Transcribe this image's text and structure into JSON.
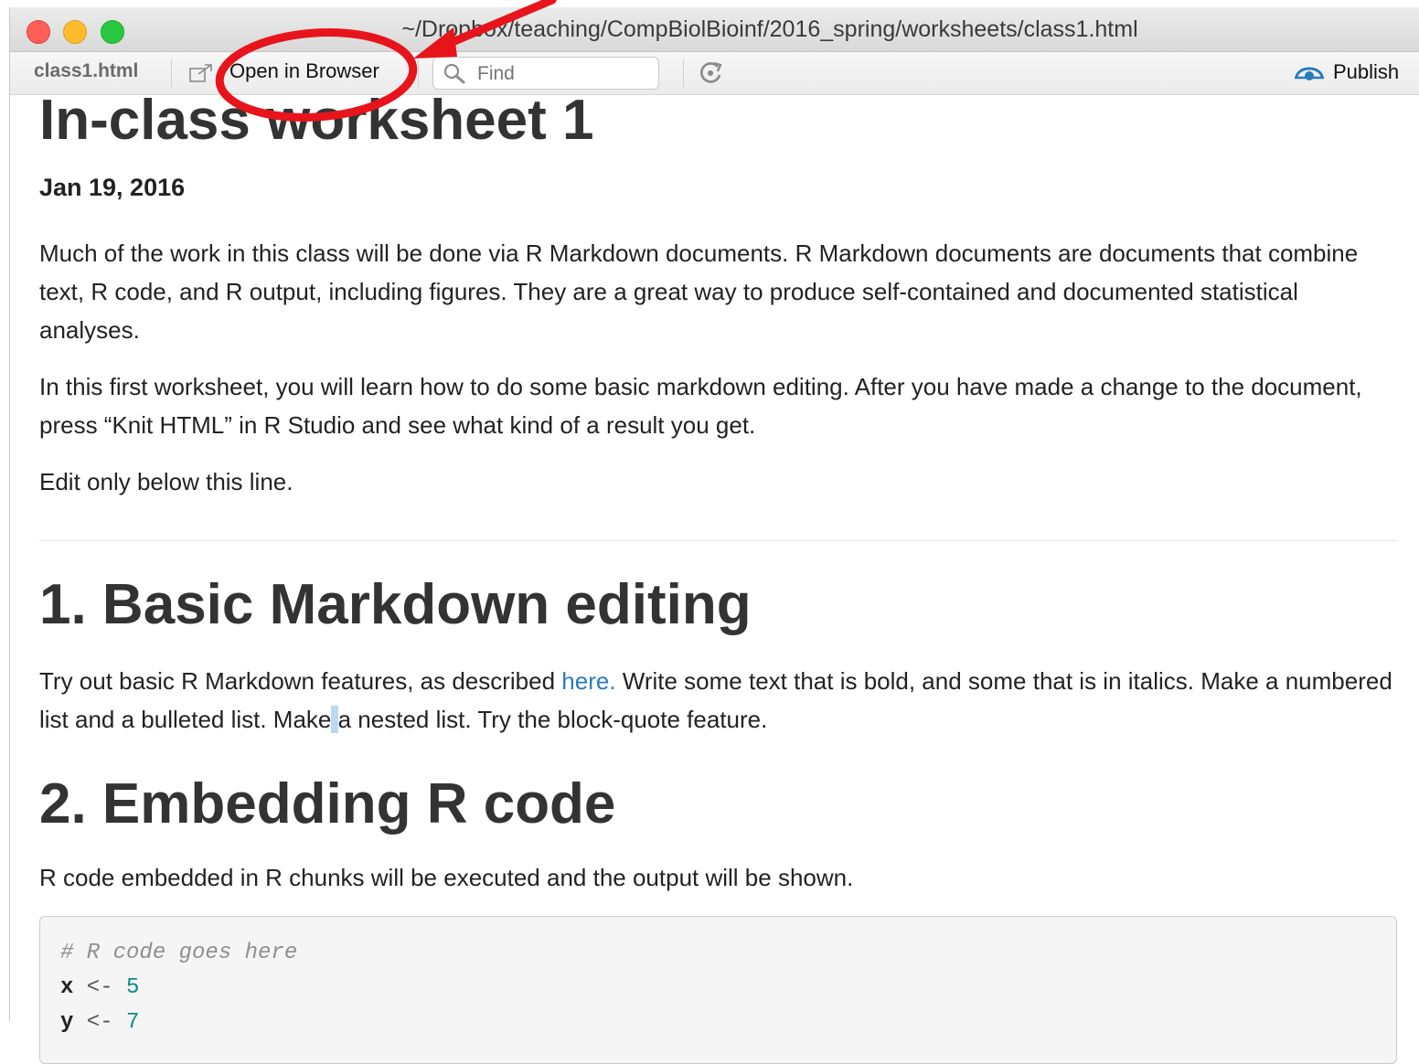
{
  "window": {
    "title": "~/Dropbox/teaching/CompBiolBioinf/2016_spring/worksheets/class1.html"
  },
  "toolbar": {
    "file_tab": "class1.html",
    "open_in_browser": "Open in Browser",
    "find_placeholder": "Find",
    "publish": "Publish"
  },
  "document": {
    "title": "In-class worksheet 1",
    "date": "Jan 19, 2016",
    "intro": "Much of the work in this class will be done via R Markdown documents. R Markdown documents are documents that combine text, R code, and R output, including figures. They are a great way to produce self-contained and documented statistical analyses.",
    "first_worksheet": "In this first worksheet, you will learn how to do some basic markdown editing. After you have made a change to the document, press “Knit HTML” in R Studio and see what kind of a result you get.",
    "edit_line": "Edit only below this line.",
    "section1": {
      "heading": "1. Basic Markdown editing",
      "text_before_link": "Try out basic R Markdown features, as described ",
      "link": "here.",
      "text_after_link_1": " Write some text that is bold, and some that is in italics. Make a numbered list and a bulleted list. Make",
      "text_cursor": " ",
      "text_after_link_2": "a nested list. Try the block-quote feature."
    },
    "section2": {
      "heading": "2. Embedding R code",
      "text": "R code embedded in R chunks will be executed and the output will be shown."
    },
    "code": {
      "comment": "# R code goes here",
      "line2_var": "x",
      "line2_op": " <- ",
      "line2_val": "5",
      "line3_var": "y",
      "line3_op": " <- ",
      "line3_val": "7"
    }
  },
  "colors": {
    "annotation": "#e8141c",
    "link": "#2a7ac0",
    "publish_icon": "#2a7ac0"
  },
  "icons": [
    "open-browser-icon",
    "search-icon",
    "refresh-icon",
    "publish-icon"
  ]
}
